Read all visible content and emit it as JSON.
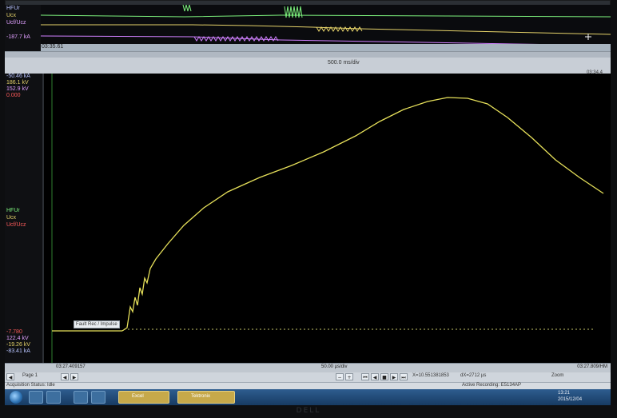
{
  "top_panel": {
    "channels": [
      {
        "label": "HFUr",
        "color": "#b8c4ff"
      },
      {
        "label": "Ucx",
        "color": "#e6d36a"
      },
      {
        "label": "Ucf/Ucz",
        "color": "#e0a0ff"
      }
    ],
    "readout": "-187.7 kA",
    "time_label": "03:35.61"
  },
  "ruler": {
    "scale_label": "500.0 ms/div",
    "right_label": "03:34.4"
  },
  "main_left": {
    "top_values": [
      {
        "text": "-50.46 kA",
        "color": "#b8c4ff"
      },
      {
        "text": "186.1 kV",
        "color": "#e6d36a"
      },
      {
        "text": "152.9 kV",
        "color": "#e0a0ff"
      },
      {
        "text": "0.000",
        "color": "#ff5b5b"
      }
    ],
    "mid_labels": [
      {
        "text": "HFUr",
        "color": "#7cf07c"
      },
      {
        "text": "Ucx",
        "color": "#e6d36a"
      },
      {
        "text": "Ucf/Ucz",
        "color": "#ff5b5b"
      }
    ],
    "bottom_values": [
      {
        "text": "-7.780",
        "color": "#ff5b5b"
      },
      {
        "text": "122.4 kV",
        "color": "#e0a0ff"
      },
      {
        "text": "-19.26 kV",
        "color": "#e6d36a"
      },
      {
        "text": "-83.41 kA",
        "color": "#b8c4ff"
      }
    ]
  },
  "main_plot": {
    "marker_label": "Fault Rec / Impulse",
    "trace_color": "#e6e05a"
  },
  "main_axis": {
    "left_time": "03:27.409157",
    "center_scale": "50.00 µs/div",
    "right_time": "03:27.809/HM"
  },
  "nav": {
    "page_label": "Page 1",
    "cursor_text": "X=10.551381853",
    "delta_text": "dX=2712 µs",
    "zoom_text": "Zoom"
  },
  "status": {
    "left": "Acquisition Status: Idle",
    "right": "Active Recording: E5134AP"
  },
  "taskbar": {
    "items": [
      "Excel",
      "Tektronix"
    ],
    "clock_time": "13:21",
    "clock_date": "2015/12/04"
  },
  "bezel_brand": "DELL"
}
